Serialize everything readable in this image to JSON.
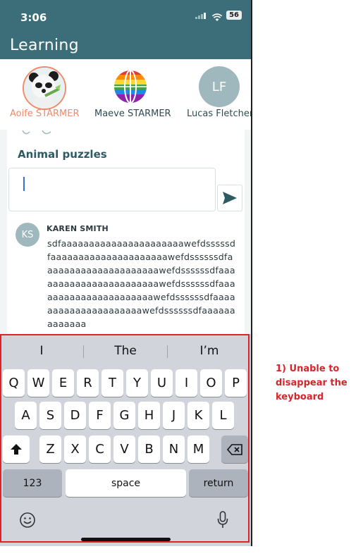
{
  "status": {
    "time": "3:06",
    "battery": "56"
  },
  "header": {
    "title": "Learning"
  },
  "participants": [
    {
      "name": "Aoife STARMER"
    },
    {
      "name": "Maeve STARMER"
    },
    {
      "name": "Lucas Fletcher",
      "initials": "LF"
    }
  ],
  "chat": {
    "title": "Animal puzzles",
    "message": {
      "initials": "KS",
      "author": "KAREN SMITH",
      "text": "sdfaaaaaaaaaaaaaaaaaaaaaawefdsssssdfaaaaaaaaaaaaaaaaaaaaawefdssssssdfaaaaaaaaaaaaaaaaaaaaawefdssssssdfaaaaaaaaaaaaaaaaaaaaaaawefdssssssdfaaaaaaaaaaaaaaaaaaaaaawefdssssssdfaaaaaaaaaaaaaaaaaaaaawefdssssssdfaaaaaaaaaaaaa"
    }
  },
  "keyboard": {
    "suggestions": [
      "I",
      "The",
      "I’m"
    ],
    "row1": [
      "Q",
      "W",
      "E",
      "R",
      "T",
      "Y",
      "U",
      "I",
      "O",
      "P"
    ],
    "row2": [
      "A",
      "S",
      "D",
      "F",
      "G",
      "H",
      "J",
      "K",
      "L"
    ],
    "row3": [
      "Z",
      "X",
      "C",
      "V",
      "B",
      "N",
      "M"
    ],
    "numbers_label": "123",
    "space_label": "space",
    "return_label": "return"
  },
  "annotation": {
    "text": "1) Unable to disappear the keyboard"
  },
  "colors": {
    "header": "#3b6e78",
    "accent": "#ef8a6a",
    "annotation": "#d6262b"
  }
}
